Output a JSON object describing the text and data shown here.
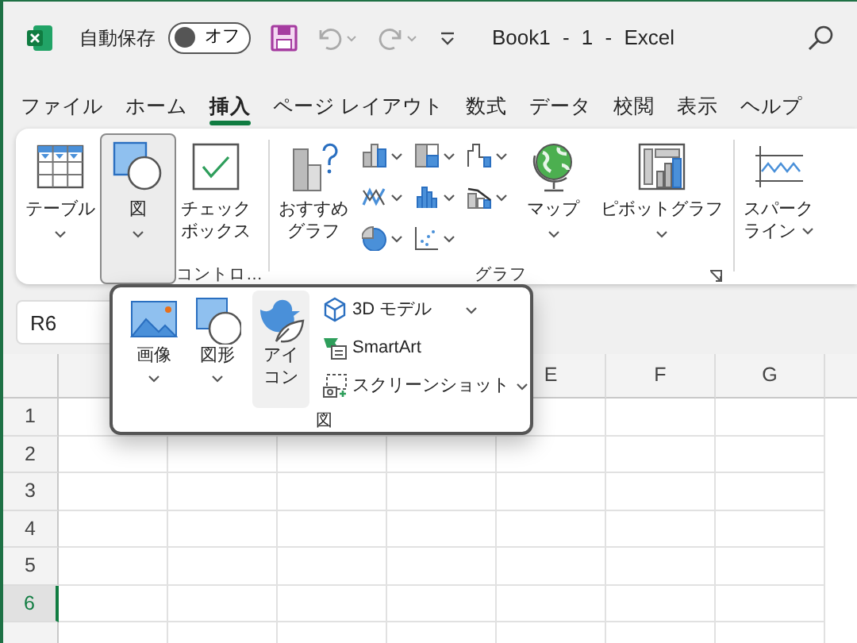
{
  "title_bar": {
    "autosave_label": "自動保存",
    "autosave_toggle": {
      "label": "オフ",
      "on": false
    },
    "title": "Book1 - 1 - Excel"
  },
  "tabs": [
    {
      "label": "ファイル",
      "selected": false
    },
    {
      "label": "ホーム",
      "selected": false
    },
    {
      "label": "挿入",
      "selected": true
    },
    {
      "label": "ページ レイアウト",
      "selected": false
    },
    {
      "label": "数式",
      "selected": false
    },
    {
      "label": "データ",
      "selected": false
    },
    {
      "label": "校閲",
      "selected": false
    },
    {
      "label": "表示",
      "selected": false
    },
    {
      "label": "ヘルプ",
      "selected": false
    }
  ],
  "ribbon": {
    "groups": [
      {
        "items": [
          {
            "kind": "large",
            "label_lines": [
              "テーブル"
            ],
            "caret": true,
            "pressed": false
          }
        ]
      },
      {
        "items": [
          {
            "kind": "large",
            "label_lines": [
              "図"
            ],
            "caret": true,
            "pressed": true
          }
        ]
      },
      {
        "label": "コントロ…",
        "items": [
          {
            "kind": "large",
            "label_lines": [
              "チェック",
              "ボックス"
            ],
            "caret": false,
            "pressed": false
          }
        ]
      },
      {
        "label": "グラフ",
        "launcher": true,
        "items": [
          {
            "kind": "large",
            "label_lines": [
              "おすすめ",
              "グラフ"
            ],
            "caret": false,
            "pressed": false
          },
          {
            "kind": "small-grid",
            "buttons": [
              {
                "caret": true
              },
              {
                "caret": true
              },
              {
                "caret": true
              },
              {
                "caret": true
              },
              {
                "caret": true
              },
              {
                "caret": true
              },
              {
                "caret": true
              },
              {
                "caret": true
              }
            ]
          },
          {
            "kind": "large",
            "label_lines": [
              "マップ"
            ],
            "caret": true,
            "pressed": false
          },
          {
            "kind": "large",
            "label_lines": [
              "ピボットグラフ"
            ],
            "caret": true,
            "pressed": false
          }
        ]
      },
      {
        "items": [
          {
            "kind": "large-inline-caret",
            "label_lines": [
              "スパーク",
              "ライン"
            ],
            "caret": true,
            "pressed": false
          }
        ]
      }
    ]
  },
  "popup": {
    "large": [
      {
        "label_lines": [
          "画像"
        ],
        "caret": true,
        "hovered": false
      },
      {
        "label_lines": [
          "図形"
        ],
        "caret": true,
        "hovered": false
      },
      {
        "label_lines": [
          "アイ",
          "コン"
        ],
        "caret": false,
        "hovered": true
      }
    ],
    "small": [
      {
        "label": "3D モデル",
        "caret": true
      },
      {
        "label": "SmartArt",
        "caret": false
      },
      {
        "label": "スクリーンショット",
        "caret": true
      }
    ],
    "group_label": "図"
  },
  "name_box": "R6",
  "column_headers": [
    "E",
    "F",
    "G"
  ],
  "rows": [
    {
      "label": "1",
      "selected": false
    },
    {
      "label": "2",
      "selected": false
    },
    {
      "label": "3",
      "selected": false
    },
    {
      "label": "4",
      "selected": false
    },
    {
      "label": "5",
      "selected": false
    },
    {
      "label": "6",
      "selected": true
    }
  ]
}
